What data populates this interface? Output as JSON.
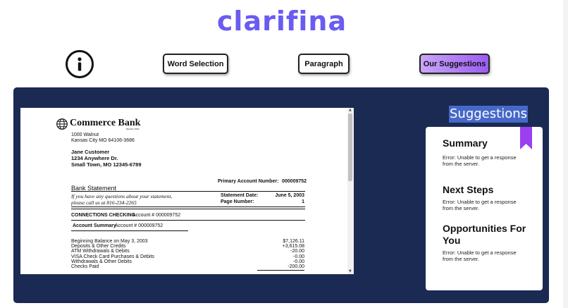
{
  "app": {
    "logo_text": "clarifina"
  },
  "nav": {
    "word_selection": "Word Selection",
    "paragraph": "Paragraph",
    "our_suggestions": "Our Suggestions"
  },
  "icons": {
    "info": "info-icon",
    "bank_logo": "globe-icon",
    "bookmark": "bookmark-icon"
  },
  "colors": {
    "logo": "#6a5cf0",
    "panel": "#1b2a52",
    "accent": "#9b5cf2",
    "highlight": "#4668c9"
  },
  "statement": {
    "bank_name": "Commerce Bank",
    "member_fdic": "Member FDIC",
    "bank_address_line1": "1000 Walnut",
    "bank_address_line2": "Kansas City MO 64106-3686",
    "customer_name": "Jane Customer",
    "customer_street": "1234 Anywhere Dr.",
    "customer_city": "Small Town, MO 12345-6789",
    "primary_account_label": "Primary Account Number:",
    "primary_account_value": "000009752",
    "heading": "Bank Statement",
    "questions_line1": "If you have any questions about your statement,",
    "questions_line2": "please call us at 816-234-2265",
    "statement_date_label": "Statement Date:",
    "statement_date_value": "June 5, 2003",
    "page_number_label": "Page Number:",
    "page_number_value": "1",
    "checking_title": "CONNECTIONS CHECKING",
    "checking_account": "Account # 000009752",
    "summary_title": "Account Summary",
    "summary_account": "Account # 000009752",
    "rows": [
      {
        "label": "Beginning Balance on May 3, 2003",
        "amount": "$7,126.11"
      },
      {
        "label": "Deposits & Other Credits",
        "amount": "+3,615.08"
      },
      {
        "label": "ATM Withdrawals & Debits",
        "amount": "-20.00"
      },
      {
        "label": "VISA Check Card Purchases & Debits",
        "amount": "-0.00"
      },
      {
        "label": "Withdrawals & Other Debits",
        "amount": "-0.00"
      },
      {
        "label": "Checks Paid",
        "amount": "-200.00"
      }
    ]
  },
  "suggestions": {
    "title": "Suggestions",
    "summary_heading": "Summary",
    "summary_text": "Error: Unable to get a response from the server.",
    "next_steps_heading": "Next Steps",
    "next_steps_text": "Error: Unable to get a response from the server.",
    "opportunities_heading_line1": "Opportunities For",
    "opportunities_heading_line2": "You",
    "opportunities_text": "Error: Unable to get a response from the server."
  }
}
